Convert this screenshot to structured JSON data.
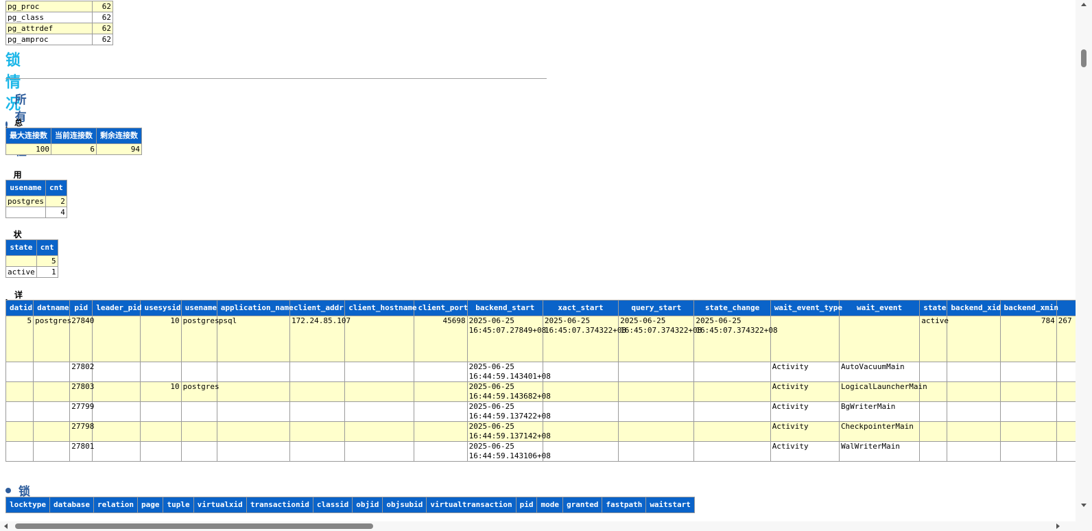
{
  "top_table": {
    "rows": [
      {
        "name": "pg_proc",
        "value": "62"
      },
      {
        "name": "pg_class",
        "value": "62"
      },
      {
        "name": "pg_attrdef",
        "value": "62"
      },
      {
        "name": "pg_amproc",
        "value": "62"
      }
    ]
  },
  "lock_section": {
    "title": "锁情况",
    "processes": {
      "title": "所有进程",
      "totals": {
        "title": "总计",
        "headers": [
          "最大连接数",
          "当前连接数",
          "剩余连接数"
        ],
        "values": [
          "100",
          "6",
          "94"
        ]
      },
      "user_stats": {
        "title": "用户统计",
        "headers": [
          "usename",
          "cnt"
        ],
        "rows": [
          [
            "postgres",
            "2"
          ],
          [
            "",
            "4"
          ]
        ]
      },
      "state_stats": {
        "title": "状态统计",
        "headers": [
          "state",
          "cnt"
        ],
        "rows": [
          [
            "",
            "5"
          ],
          [
            "active",
            "1"
          ]
        ]
      },
      "details": {
        "title": "详情",
        "headers": [
          "datid",
          "datname",
          "pid",
          "leader_pid",
          "usesysid",
          "usename",
          "application_name",
          "client_addr",
          "client_hostname",
          "client_port",
          "backend_start",
          "xact_start",
          "query_start",
          "state_change",
          "wait_event_type",
          "wait_event",
          "state",
          "backend_xid",
          "backend_xmin",
          ""
        ],
        "rows": [
          [
            "5",
            "postgres",
            "27840",
            "",
            "10",
            "postgres",
            "psql",
            "172.24.85.107",
            "",
            "45698",
            "2025-06-25 16:45:07.27849+08",
            "2025-06-25 16:45:07.374322+08",
            "2025-06-25 16:45:07.374322+08",
            "2025-06-25 16:45:07.374322+08",
            "",
            "",
            "active",
            "",
            "784",
            "267"
          ],
          [
            "",
            "",
            "27802",
            "",
            "",
            "",
            "",
            "",
            "",
            "",
            "2025-06-25 16:44:59.143401+08",
            "",
            "",
            "",
            "Activity",
            "AutoVacuumMain",
            "",
            "",
            "",
            ""
          ],
          [
            "",
            "",
            "27803",
            "",
            "10",
            "postgres",
            "",
            "",
            "",
            "",
            "2025-06-25 16:44:59.143682+08",
            "",
            "",
            "",
            "Activity",
            "LogicalLauncherMain",
            "",
            "",
            "",
            ""
          ],
          [
            "",
            "",
            "27799",
            "",
            "",
            "",
            "",
            "",
            "",
            "",
            "2025-06-25 16:44:59.137422+08",
            "",
            "",
            "",
            "Activity",
            "BgWriterMain",
            "",
            "",
            "",
            ""
          ],
          [
            "",
            "",
            "27798",
            "",
            "",
            "",
            "",
            "",
            "",
            "",
            "2025-06-25 16:44:59.137142+08",
            "",
            "",
            "",
            "Activity",
            "CheckpointerMain",
            "",
            "",
            "",
            ""
          ],
          [
            "",
            "",
            "27801",
            "",
            "",
            "",
            "",
            "",
            "",
            "",
            "2025-06-25 16:44:59.143106+08",
            "",
            "",
            "",
            "Activity",
            "WalWriterMain",
            "",
            "",
            "",
            ""
          ]
        ]
      }
    },
    "locks": {
      "title": "锁",
      "headers": [
        "locktype",
        "database",
        "relation",
        "page",
        "tuple",
        "virtualxid",
        "transactionid",
        "classid",
        "objid",
        "objsubid",
        "virtualtransaction",
        "pid",
        "mode",
        "granted",
        "fastpath",
        "waitstart"
      ]
    }
  },
  "colors": {
    "header_bg": "#0a63c9",
    "row_odd": "#ffffcc",
    "h1": "#19b6e8",
    "h2": "#2e5d9c"
  }
}
